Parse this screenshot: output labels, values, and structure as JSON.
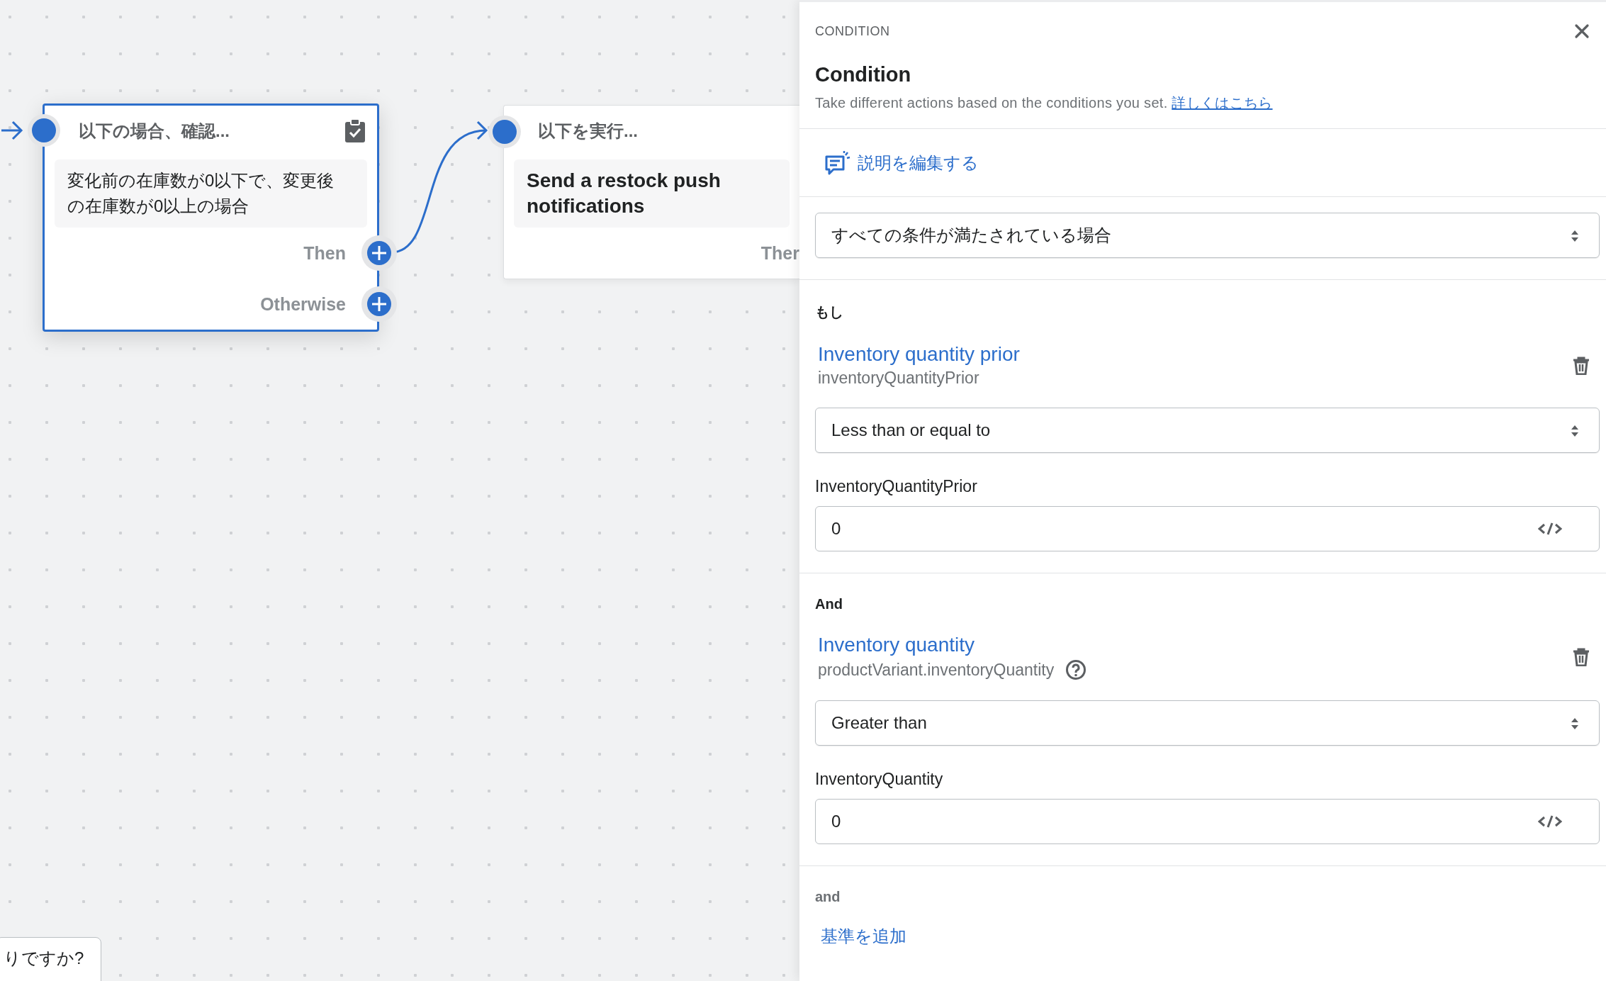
{
  "canvas": {
    "nodes": [
      {
        "kind": "condition",
        "selected": true,
        "title": "以下の場合、確認...",
        "description": "変化前の在庫数が0以下で、変更後の在庫数が0以上の場合",
        "outputs": [
          "Then",
          "Otherwise"
        ]
      },
      {
        "kind": "action",
        "selected": false,
        "title": "以下を実行...",
        "description": "Send a restock push notifications",
        "outputs": [
          "Ther"
        ]
      }
    ],
    "help_button": "りですか?"
  },
  "panel": {
    "eyebrow": "CONDITION",
    "title": "Condition",
    "description": "Take different actions based on the conditions you set.",
    "learn_more_link": "詳しくはこちら",
    "edit_description": "説明を編集する",
    "match_select": "すべての条件が満たされている場合",
    "criteria": [
      {
        "connector": "もし",
        "field": "Inventory quantity prior",
        "path": "inventoryQuantityPrior",
        "help": false,
        "operator": "Less than or equal to",
        "value_label": "InventoryQuantityPrior",
        "value": "0"
      },
      {
        "connector": "And",
        "field": "Inventory quantity",
        "path": "productVariant.inventoryQuantity",
        "help": true,
        "operator": "Greater than",
        "value_label": "InventoryQuantity",
        "value": "0"
      }
    ],
    "add_connector": "and",
    "add_criterion": "基準を追加"
  }
}
